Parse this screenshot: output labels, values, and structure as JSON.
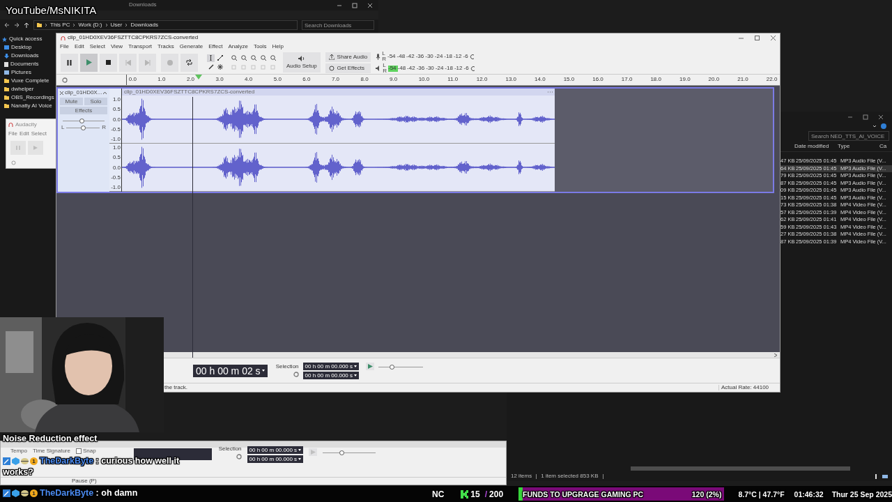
{
  "overlay_caption": "YouTube/MsNIKITA",
  "explorer": {
    "title": "Downloads",
    "breadcrumb": [
      "This PC",
      "Work (D:)",
      "User",
      "Downloads"
    ],
    "search": {
      "placeholder": "Search Downloads"
    },
    "sidebar": [
      {
        "label": "Quick access",
        "kind": "star"
      },
      {
        "label": "Desktop",
        "kind": "desktop"
      },
      {
        "label": "Downloads",
        "kind": "download"
      },
      {
        "label": "Documents",
        "kind": "document"
      },
      {
        "label": "Pictures",
        "kind": "pictures"
      },
      {
        "label": "Vuxe Complete",
        "kind": "folder"
      },
      {
        "label": "dwhelper",
        "kind": "folder"
      },
      {
        "label": "OBS_Recordings",
        "kind": "folder"
      },
      {
        "label": "Nanatty AI Voice",
        "kind": "folder"
      }
    ]
  },
  "small_audacity": {
    "title": "Audacity",
    "menu": [
      "File",
      "Edit",
      "Select"
    ]
  },
  "explorer_right": {
    "search": {
      "placeholder": "Search NED_TTS_AI_VOICE"
    },
    "columns": [
      "Date modified",
      "Type",
      "Ca"
    ],
    "rows": [
      {
        "size": "47 KB",
        "date": "25/09/2025 01:45",
        "type": "MP3 Audio File (V...",
        "selected": false
      },
      {
        "size": "64 KB",
        "date": "25/09/2025 01:45",
        "type": "MP3 Audio File (V...",
        "selected": true
      },
      {
        "size": "79 KB",
        "date": "25/09/2025 01:45",
        "type": "MP3 Audio File (V...",
        "selected": false
      },
      {
        "size": "87 KB",
        "date": "25/09/2025 01:45",
        "type": "MP3 Audio File (V...",
        "selected": false
      },
      {
        "size": "09 KB",
        "date": "25/09/2025 01:45",
        "type": "MP3 Audio File (V...",
        "selected": false
      },
      {
        "size": "15 KB",
        "date": "25/09/2025 01:45",
        "type": "MP3 Audio File (V...",
        "selected": false
      },
      {
        "size": "73 KB",
        "date": "25/09/2025 01:38",
        "type": "MP4 Video File (V...",
        "selected": false
      },
      {
        "size": "57 KB",
        "date": "25/09/2025 01:39",
        "type": "MP4 Video File (V...",
        "selected": false
      },
      {
        "size": "62 KB",
        "date": "25/09/2025 01:41",
        "type": "MP4 Video File (V...",
        "selected": false
      },
      {
        "size": "59 KB",
        "date": "25/09/2025 01:43",
        "type": "MP4 Video File (V...",
        "selected": false
      },
      {
        "size": "27 KB",
        "date": "25/09/2025 01:38",
        "type": "MP4 Video File (V...",
        "selected": false
      },
      {
        "size": "87 KB",
        "date": "25/09/2025 01:39",
        "type": "MP4 Video File (V...",
        "selected": false
      }
    ],
    "status": [
      "12 items",
      "1 item selected 853 KB"
    ]
  },
  "audacity": {
    "title": "clip_01HD0XEV36FSZTTC8CPKRS7ZCS-converted",
    "menu": [
      "File",
      "Edit",
      "Select",
      "View",
      "Transport",
      "Tracks",
      "Generate",
      "Effect",
      "Analyze",
      "Tools",
      "Help"
    ],
    "transport": [
      {
        "kind": "pause",
        "disabled": false,
        "pressed": false
      },
      {
        "kind": "play",
        "disabled": false,
        "pressed": true
      },
      {
        "kind": "stop",
        "disabled": false,
        "pressed": false
      },
      {
        "kind": "skip-start",
        "disabled": true,
        "pressed": false
      },
      {
        "kind": "skip-end",
        "disabled": true,
        "pressed": false
      },
      {
        "kind": "record",
        "disabled": true,
        "pressed": false
      },
      {
        "kind": "loop",
        "disabled": false,
        "pressed": false
      }
    ],
    "audio_setup": "Audio Setup",
    "share_audio": "Share Audio",
    "get_effects": "Get Effects",
    "meters": [
      {
        "kind": "record",
        "channels": [
          "L",
          "R"
        ],
        "scale": [
          "-54",
          "-48",
          "-42",
          "-36",
          "-30",
          "-24",
          "-18",
          "-12",
          "-6"
        ]
      },
      {
        "kind": "playback",
        "channels": [
          "L",
          "R"
        ],
        "level": 0.12,
        "scale": [
          "-54",
          "-48",
          "-42",
          "-36",
          "-30",
          "-24",
          "-18",
          "-12",
          "-6"
        ]
      }
    ],
    "ruler": [
      "0.0",
      "1.0",
      "2.0",
      "3.0",
      "4.0",
      "5.0",
      "6.0",
      "7.0",
      "8.0",
      "9.0",
      "10.0",
      "11.0",
      "12.0",
      "13.0",
      "14.0",
      "15.0",
      "16.0",
      "17.0",
      "18.0",
      "19.0",
      "20.0",
      "21.0",
      "22.0"
    ],
    "playhead": {
      "level": 0.11
    },
    "track": {
      "name": "clip_01HD0X...",
      "clip_title": "clip_01HD0XEV36FSZTTC8CPKRS7ZCS-converted",
      "buttons": [
        "Mute",
        "Solo"
      ],
      "effects": "Effects",
      "gain": {
        "level": 0.45
      },
      "pan": {
        "labels": [
          "L",
          "R"
        ],
        "level": 0.5
      },
      "channels": [
        {
          "scale": [
            "1.0",
            "0.5",
            "0.0",
            "-0.5",
            "-1.0"
          ]
        },
        {
          "scale": [
            "1.0",
            "0.5",
            "0.0",
            "-0.5",
            "-1.0"
          ]
        }
      ]
    },
    "time": "00 h 00 m 02 s",
    "selection_label": "Selection",
    "selection": [
      "00 h 00 m 00.000 s",
      "00 h 00 m 00.000 s"
    ],
    "speed": {
      "level": 0.3
    },
    "status": {
      "hint": "the track.",
      "rate": "Actual Rate: 44100"
    }
  },
  "lower_audacity": {
    "labels": [
      "Tempo",
      "Time Signature"
    ],
    "snap": {
      "label": "Snap",
      "checked": false
    },
    "selection_label": "Selection",
    "selection": [
      "00 h 00 m 00.000 s",
      "00 h 00 m 00.000 s"
    ],
    "speed": {
      "level": 0.35
    },
    "hint": "Pause (P)"
  },
  "chat": [
    {
      "kind": "continuation",
      "text": "Noise Reduction effect"
    },
    {
      "kind": "message",
      "user": "TheDarkByte",
      "badge_number": "1",
      "text": ": curious how well it works?"
    },
    {
      "kind": "message",
      "user": "TheDarkByte",
      "badge_number": "1",
      "text": ": oh damn"
    }
  ],
  "bottom_bar": {
    "tag": "NC",
    "counter": [
      "15",
      "/",
      "200"
    ],
    "goal": {
      "title": "FUNDS TO UPGRAGE GAMING PC",
      "amount": "120 (2%)",
      "level": 0.02
    },
    "weather": "8.7°C | 47.7°F",
    "time": "01:46:32",
    "date": "Thur 25 Sep 2025"
  }
}
